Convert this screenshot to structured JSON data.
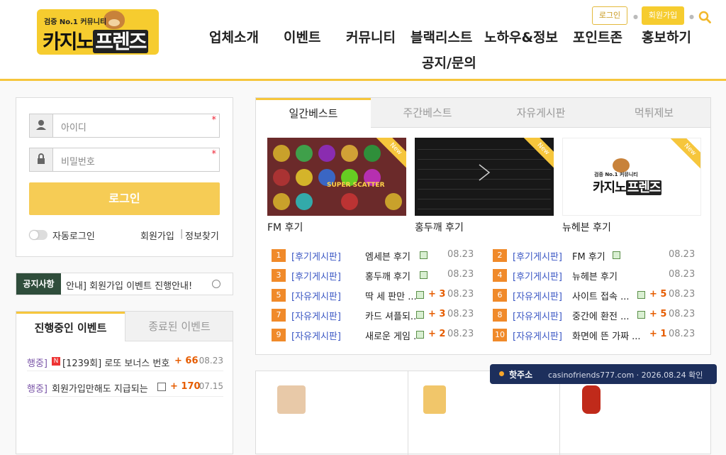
{
  "logo": {
    "tagline": "검증 No.1 커뮤니티",
    "name_part1": "카지노",
    "name_part2": "프렌즈"
  },
  "nav": {
    "items": [
      "업체소개",
      "이벤트",
      "커뮤니티",
      "블랙리스트",
      "노하우&정보",
      "포인트존",
      "홍보하기",
      "공지/문의"
    ]
  },
  "top": {
    "login": "로그인",
    "join": "회원가입"
  },
  "login": {
    "id_placeholder": "아이디",
    "pw_placeholder": "비밀번호",
    "required": "*",
    "button": "로그인",
    "auto_login": "자동로그인",
    "join": "회원가입",
    "sep": "|",
    "find": "정보찾기"
  },
  "notice": {
    "label": "공지사항",
    "text": "안내] 회원가입 이벤트 진행안내!"
  },
  "events": {
    "tab_active": "진행중인 이벤트",
    "tab_inactive": "종료된 이벤트",
    "items": [
      {
        "tag": "행중]",
        "badge": "N",
        "title": "[1239회] 로또 보너스 번호",
        "count": "+ 66",
        "date": "08.23"
      },
      {
        "tag": "행중]",
        "badge": "",
        "title": "회원가입만해도 지급되는",
        "count": "+ 170",
        "date": "07.15"
      }
    ]
  },
  "board": {
    "tabs": [
      "일간베스트",
      "주간베스트",
      "자유게시판",
      "먹튀제보"
    ],
    "thumbs": [
      {
        "caption": "FM 후기",
        "ribbon": "New",
        "slot_text": "SUPER SCATTER"
      },
      {
        "caption": "홍두깨 후기",
        "ribbon": "New"
      },
      {
        "caption": "뉴헤븐 후기",
        "ribbon": "New"
      }
    ],
    "posts": [
      {
        "num": "1",
        "cat": "[후기게시판]",
        "title": "엠세븐 후기",
        "count": "",
        "date": "08.23"
      },
      {
        "num": "2",
        "cat": "[후기게시판]",
        "title": "FM 후기",
        "count": "",
        "date": "08.23"
      },
      {
        "num": "3",
        "cat": "[후기게시판]",
        "title": "홍두깨 후기",
        "count": "",
        "date": "08.23"
      },
      {
        "num": "4",
        "cat": "[후기게시판]",
        "title": "뉴헤븐 후기",
        "count": "",
        "date": "08.23"
      },
      {
        "num": "5",
        "cat": "[자유게시판]",
        "title": "딱 세 판만 ...",
        "count": "+ 3",
        "date": "08.23"
      },
      {
        "num": "6",
        "cat": "[자유게시판]",
        "title": "사이트 접속 ...",
        "count": "+ 5",
        "date": "08.23"
      },
      {
        "num": "7",
        "cat": "[자유게시판]",
        "title": "카드 셔플되...",
        "count": "+ 3",
        "date": "08.23"
      },
      {
        "num": "8",
        "cat": "[자유게시판]",
        "title": "중간에 환전 ...",
        "count": "+ 5",
        "date": "08.23"
      },
      {
        "num": "9",
        "cat": "[자유게시판]",
        "title": "새로운 게임 ...",
        "count": "+ 2",
        "date": "08.23"
      },
      {
        "num": "10",
        "cat": "[자유게시판]",
        "title": "화면에 뜬 가짜 ...",
        "count": "+ 1",
        "date": "08.23"
      }
    ]
  },
  "hotbar": {
    "label": "핫주소",
    "value": "casinofriends777.com · 2026.08.24 확인"
  },
  "colors": {
    "accent": "#f6c63c",
    "category": "#3b57c4",
    "count": "#e65c00",
    "notice_bg": "#2f4d3b",
    "hotbar_bg": "#1d2f5c"
  }
}
